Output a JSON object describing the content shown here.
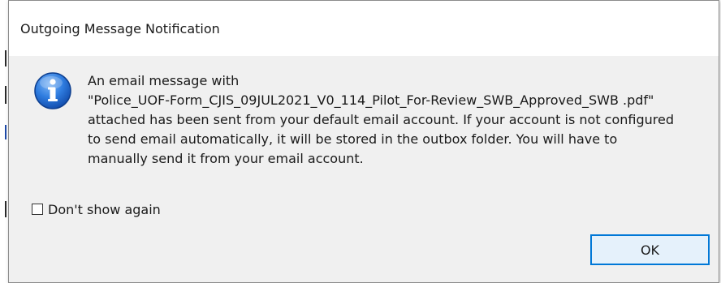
{
  "dialog": {
    "title": "Outgoing Message Notification",
    "icon": "info-icon",
    "message_lines": [
      "An email message with",
      "\"Police_UOF-Form_CJIS_09JUL2021_V0_114_Pilot_For-Review_SWB_Approved_SWB .pdf\"",
      "attached has been sent from your default email account. If your account is not configured",
      "to send email automatically, it will be stored in the outbox folder. You will have to",
      "manually send it from your email account."
    ],
    "checkbox": {
      "label": "Don't show again",
      "checked": false
    },
    "ok_label": "OK"
  },
  "colors": {
    "dialog_background": "#f0f0f0",
    "titlebar_background": "#ffffff",
    "button_border": "#0078d7",
    "button_background": "#e5f1fb",
    "info_icon_blue": "#1e64c8"
  }
}
